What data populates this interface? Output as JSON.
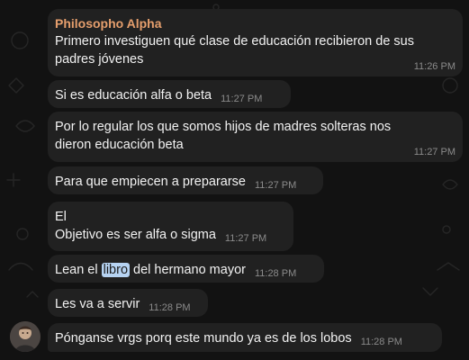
{
  "chat": {
    "sender_name": "Philosopho Alpha",
    "messages": [
      {
        "line1": "Primero investiguen qué clase de educación recibieron de sus",
        "line2": "padres jóvenes",
        "time": "11:26 PM"
      },
      {
        "text": "Si es educación alfa o beta",
        "time": "11:27 PM"
      },
      {
        "line1": "Por lo regular los que somos hijos de madres solteras nos",
        "line2": "dieron educación beta",
        "time": "11:27 PM"
      },
      {
        "text": "Para que empiecen a prepararse",
        "time": "11:27 PM"
      },
      {
        "line1": "El",
        "line2": "Objetivo es ser alfa o sigma",
        "time": "11:27 PM"
      },
      {
        "text_before": "Lean el ",
        "link": "libro",
        "text_after": " del hermano mayor",
        "time": "11:28 PM"
      },
      {
        "text": "Les va a servir",
        "time": "11:28 PM"
      },
      {
        "text": "Pónganse vrgs porq este mundo ya es de los lobos",
        "time": "11:28 PM"
      }
    ]
  },
  "theme": {
    "background": "#121212",
    "bubble": "#212121",
    "sender_color": "#e69f6d",
    "time_color": "#8b8b8b",
    "highlight": "#b6d3f2"
  },
  "icons": {
    "avatar": "user-avatar-icon",
    "pattern": "doodle-background-pattern"
  }
}
